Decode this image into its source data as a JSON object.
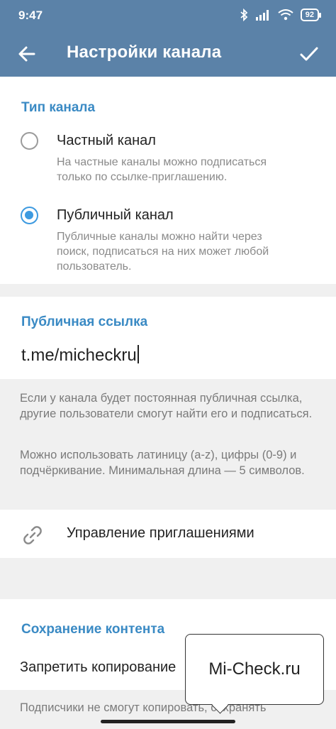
{
  "status_bar": {
    "time": "9:47",
    "battery": "92",
    "icons": [
      "bluetooth-icon",
      "signal-icon",
      "wifi-icon",
      "battery-icon"
    ]
  },
  "app_bar": {
    "title": "Настройки канала",
    "color": "#5b82a8",
    "back_icon": "arrow-left-icon",
    "confirm_icon": "check-icon"
  },
  "channel_type": {
    "section_title": "Тип канала",
    "options": [
      {
        "label": "Частный канал",
        "description": "На частные каналы можно подписаться только по ссылке-приглашению.",
        "selected": false
      },
      {
        "label": "Публичный канал",
        "description": "Публичные каналы можно найти через поиск, подписаться на них может любой пользователь.",
        "selected": true
      }
    ]
  },
  "public_link": {
    "section_title": "Публичная ссылка",
    "value": "t.me/micheckru",
    "hints": [
      "Если у канала будет постоянная публичная ссылка, другие пользователи смогут найти его и подписаться.",
      "Можно использовать латиницу (a-z), цифры (0-9) и подчёркивание. Минимальная длина — 5 символов."
    ]
  },
  "invites": {
    "label": "Управление приглашениями",
    "icon": "link-icon"
  },
  "content_saving": {
    "section_title": "Сохранение контента",
    "row_label": "Запретить копирование",
    "hint": "Подписчики не смогут копировать, сохранять"
  },
  "watermark": {
    "text": "Mi-Check.ru"
  },
  "accent_color": "#3a8ac4"
}
